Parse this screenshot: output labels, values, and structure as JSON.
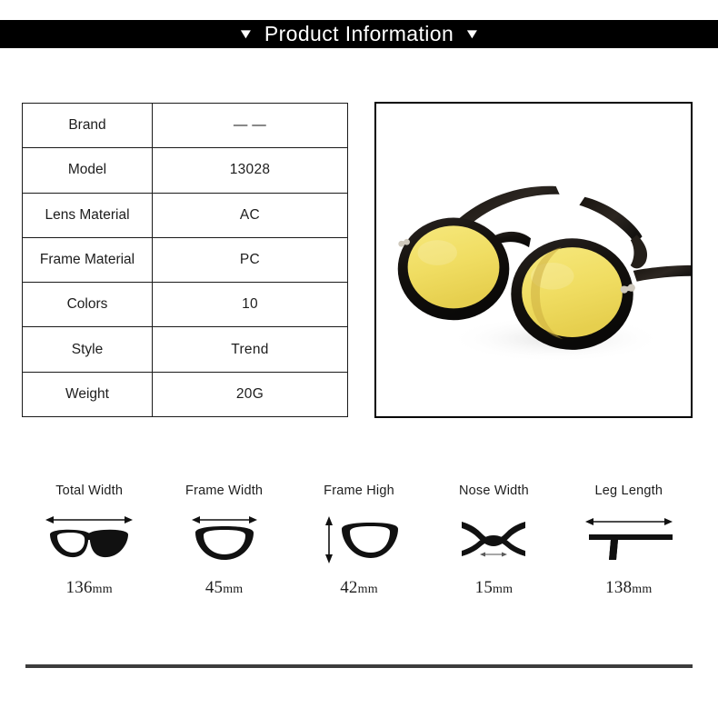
{
  "header": {
    "title": "Product Information",
    "caret_left": "▼",
    "caret_right": "▼"
  },
  "spec_table": {
    "rows": [
      {
        "label": "Brand",
        "value": "— —"
      },
      {
        "label": "Model",
        "value": "13028"
      },
      {
        "label": "Lens Material",
        "value": "AC"
      },
      {
        "label": "Frame Material",
        "value": "PC"
      },
      {
        "label": "Colors",
        "value": "10"
      },
      {
        "label": "Style",
        "value": "Trend"
      },
      {
        "label": "Weight",
        "value": "20G"
      }
    ]
  },
  "product_photo": {
    "alt": "round black frame sunglasses with yellow tinted lenses",
    "frame_color": "#15120f",
    "lens_color": "#f2e06a",
    "background": "#ffffff"
  },
  "measurements": [
    {
      "label": "Total Width",
      "number": "136",
      "unit": "mm",
      "icon": "full-glasses-front-icon"
    },
    {
      "label": "Frame Width",
      "number": "45",
      "unit": "mm",
      "icon": "single-lens-width-icon"
    },
    {
      "label": "Frame High",
      "number": "42",
      "unit": "mm",
      "icon": "single-lens-height-icon"
    },
    {
      "label": "Nose Width",
      "number": "15",
      "unit": "mm",
      "icon": "nose-bridge-icon"
    },
    {
      "label": "Leg Length",
      "number": "138",
      "unit": "mm",
      "icon": "temple-arm-icon"
    }
  ],
  "colors": {
    "banner_background": "#000000",
    "banner_text": "#ffffff",
    "table_border": "#1a1a1a",
    "text": "#1d1d1d",
    "divider": "#3c3c3c"
  }
}
